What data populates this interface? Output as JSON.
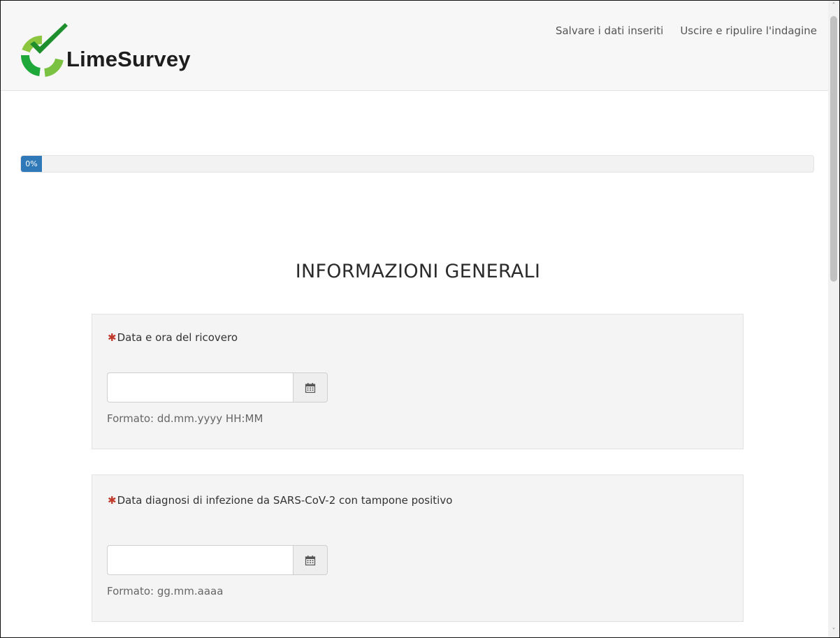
{
  "header": {
    "logo_text": "LimeSurvey",
    "links": [
      "Salvare i dati inseriti",
      "Uscire e ripulire l'indagine"
    ]
  },
  "progress": {
    "value": 0,
    "label": "0%"
  },
  "group": {
    "title": "INFORMAZIONI GENERALI"
  },
  "questions": [
    {
      "mandatory_mark": "✱",
      "text": "Data e ora del ricovero",
      "value": "",
      "hint": "Formato: dd.mm.yyyy HH:MM",
      "button_icon": "calendar-icon"
    },
    {
      "mandatory_mark": "✱",
      "text": "Data diagnosi di infezione da SARS-CoV-2 con tampone positivo",
      "value": "",
      "hint": "Formato: gg.mm.aaaa",
      "button_icon": "calendar-icon"
    }
  ],
  "colors": {
    "accent": "#2f79b9",
    "logo_green": "#8cc63f",
    "mandatory": "#c0392b"
  }
}
